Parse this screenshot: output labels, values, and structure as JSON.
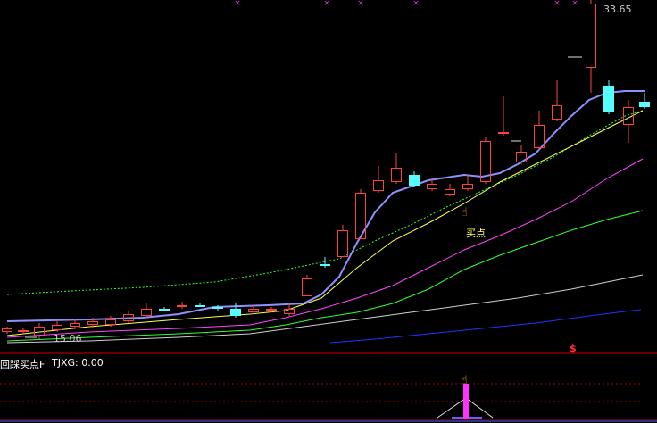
{
  "colors": {
    "background": "#000000",
    "up": "#ff4040",
    "down": "#55ffff",
    "ma5": "#9090ff",
    "ma10": "#ffff55",
    "ma20": "#ff44ff",
    "ma30": "#33ff33",
    "ma60": "#cfcfcf",
    "ma120": "#2233ff",
    "dotted": "#33ff33",
    "signal": "#ff33ff"
  },
  "main_chart": {
    "price_high_label": "33.65",
    "price_low_label": "15.06",
    "buy_point_label": "买点",
    "signal_mark": "$",
    "hand_icon": "pointing-hand-icon",
    "top_markers_icon": "x-mark"
  },
  "indicator": {
    "name": "回踩买点F",
    "value_text": "TJXG: 0.00"
  },
  "candles": [
    [
      8,
      372,
      368,
      374,
      366
    ],
    [
      26,
      372,
      370,
      374,
      368
    ],
    [
      44,
      377,
      366,
      380,
      362
    ],
    [
      64,
      370,
      364,
      372,
      360
    ],
    [
      84,
      366,
      362,
      368,
      358
    ],
    [
      104,
      364,
      360,
      368,
      356
    ],
    [
      124,
      364,
      358,
      366,
      354
    ],
    [
      144,
      360,
      352,
      362,
      348
    ],
    [
      164,
      354,
      346,
      356,
      340
    ],
    [
      184,
      346,
      346,
      348,
      344
    ],
    [
      204,
      344,
      342,
      346,
      338
    ],
    [
      224,
      342,
      342,
      344,
      340
    ],
    [
      244,
      344,
      346,
      348,
      342
    ],
    [
      264,
      346,
      354,
      356,
      340
    ],
    [
      284,
      350,
      346,
      352,
      342
    ],
    [
      304,
      348,
      346,
      350,
      344
    ],
    [
      324,
      352,
      346,
      354,
      340
    ],
    [
      344,
      332,
      312,
      332,
      308
    ],
    [
      364,
      296,
      296,
      300,
      288
    ],
    [
      384,
      288,
      258,
      288,
      252
    ],
    [
      404,
      268,
      216,
      268,
      212
    ],
    [
      424,
      214,
      202,
      216,
      186
    ],
    [
      444,
      204,
      188,
      206,
      172
    ],
    [
      464,
      196,
      208,
      210,
      192
    ],
    [
      484,
      212,
      206,
      214,
      200
    ],
    [
      504,
      218,
      212,
      220,
      206
    ],
    [
      524,
      212,
      206,
      214,
      196
    ],
    [
      544,
      204,
      158,
      206,
      154
    ],
    [
      564,
      150,
      148,
      152,
      108
    ],
    [
      584,
      182,
      170,
      184,
      162
    ],
    [
      604,
      166,
      140,
      168,
      124
    ],
    [
      624,
      134,
      118,
      136,
      90
    ],
    [
      662,
      76,
      4,
      104,
      0
    ],
    [
      682,
      96,
      126,
      128,
      90
    ],
    [
      704,
      140,
      120,
      160,
      112
    ],
    [
      722,
      114,
      120,
      122,
      104
    ]
  ],
  "dashes": [
    [
      572,
      158,
      584,
      158
    ],
    [
      636,
      64,
      652,
      64
    ],
    [
      28,
      378,
      42,
      378
    ]
  ]
}
